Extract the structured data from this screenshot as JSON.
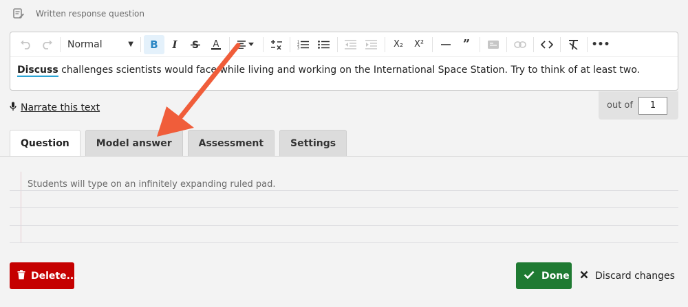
{
  "header": {
    "title": "Written response question",
    "icon": "document-edit-icon"
  },
  "toolbar": {
    "format_label": "Normal",
    "buttons": [
      "undo-icon",
      "redo-icon",
      "bold-icon",
      "italic-icon",
      "strikethrough-icon",
      "text-color-icon",
      "align-icon",
      "formula-icon",
      "ordered-list-icon",
      "bullet-list-icon",
      "outdent-icon",
      "indent-icon",
      "subscript-icon",
      "superscript-icon",
      "horizontal-rule-icon",
      "quote-icon",
      "image-icon",
      "link-icon",
      "code-icon",
      "clear-format-icon",
      "more-icon"
    ],
    "subscript_glyph": "X₂",
    "superscript_glyph": "X²"
  },
  "question": {
    "emphasis": "Discuss",
    "text": " challenges scientists would face while living and working on the International Space Station. Try to think of at least two."
  },
  "narrate": {
    "label": "Narrate this text"
  },
  "points": {
    "label": "out of",
    "value": "1"
  },
  "tabs": [
    {
      "label": "Question",
      "active": true
    },
    {
      "label": "Model answer",
      "active": false
    },
    {
      "label": "Assessment",
      "active": false
    },
    {
      "label": "Settings",
      "active": false
    }
  ],
  "response_area": {
    "placeholder": "Students will type on an infinitely expanding ruled pad."
  },
  "actions": {
    "delete": "Delete...",
    "done": "Done",
    "discard": "Discard changes"
  },
  "colors": {
    "delete": "#c50000",
    "done": "#1f7a32",
    "annotation_arrow": "#f05d3a",
    "bold_active": "#2a86c4"
  }
}
